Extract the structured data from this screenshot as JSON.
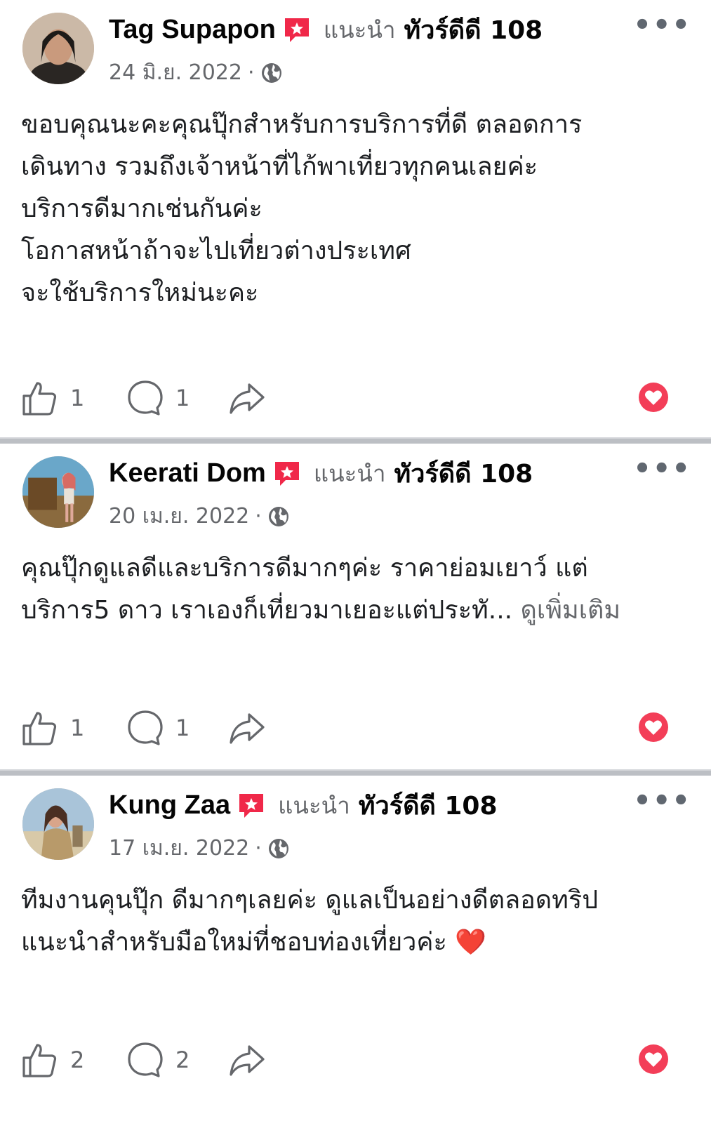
{
  "reviews": [
    {
      "name": "Tag Supapon",
      "recommend_label": "แนะนำ",
      "page_name": "ทัวร์ดีดี 108",
      "date": "24 มิ.ย. 2022",
      "dot": "·",
      "text": "ขอบคุณนะคะคุณปุ๊กสำหรับการบริการที่ดี ตลอดการ\nเดินทาง รวมถึงเจ้าหน้าที่ไก้พาเที่ยวทุกคนเลยค่ะ\nบริการดีมากเช่นกันค่ะ\nโอกาสหน้าถ้าจะไปเที่ยวต่างประเทศ\nจะใช้บริการใหม่นะคะ",
      "see_more": "",
      "likes": "1",
      "comments": "1"
    },
    {
      "name": "Keerati Dom",
      "recommend_label": "แนะนำ",
      "page_name": "ทัวร์ดีดี 108",
      "date": "20 เม.ย. 2022",
      "dot": "·",
      "text": "คุณปุ๊กดูแลดีและบริการดีมากๆค่ะ ราคาย่อมเยาว์ แต่\nบริการ5 ดาว เราเองก็เที่ยวมาเยอะแต่ประทั... ",
      "see_more": "ดูเพิ่มเติม",
      "likes": "1",
      "comments": "1"
    },
    {
      "name": "Kung Zaa",
      "recommend_label": "แนะนำ",
      "page_name": "ทัวร์ดีดี 108",
      "date": "17 เม.ย. 2022",
      "dot": "·",
      "text": "ทีมงานคุนปุ๊ก ดีมากๆเลยค่ะ ดูแลเป็นอย่างดีตลอดทริป\nแนะนำสำหรับมือใหม่ที่ชอบท่องเที่ยวค่ะ ❤️",
      "see_more": "",
      "likes": "2",
      "comments": "2"
    }
  ],
  "colors": {
    "recommend_badge": "#f02849",
    "secondary_text": "#65676b",
    "divider": "#bcbfc4"
  },
  "icons": [
    "recommend-badge-icon",
    "globe-icon",
    "like-icon",
    "comment-icon",
    "share-icon",
    "love-reaction-icon",
    "more-icon"
  ]
}
